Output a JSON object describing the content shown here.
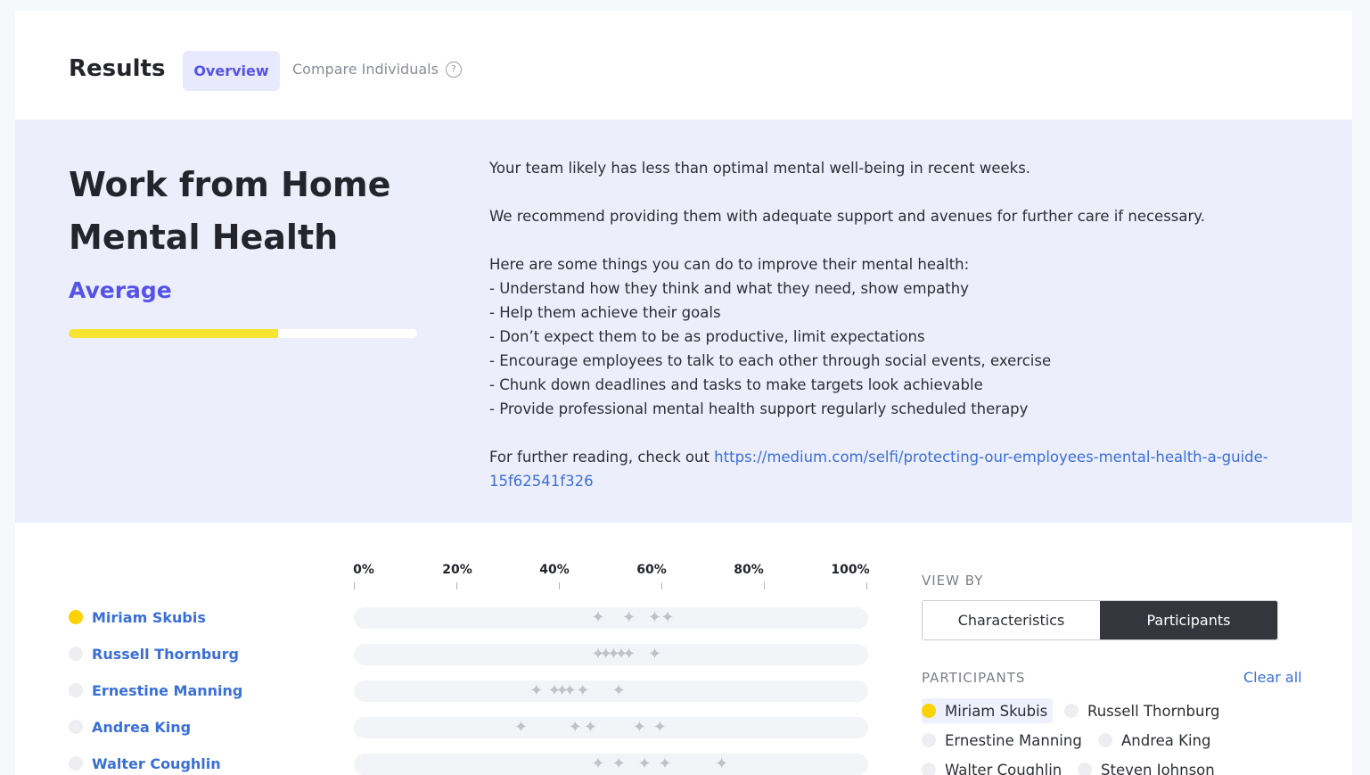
{
  "header": {
    "title": "Results",
    "tabs": [
      {
        "label": "Overview",
        "active": true
      },
      {
        "label": "Compare Individuals",
        "active": false
      }
    ]
  },
  "summary": {
    "title_line1": "Work from Home",
    "title_line2": "Mental Health",
    "level": "Average",
    "level_fraction": 0.6,
    "level_color": "#f7e531",
    "paragraph1": "Your team likely has less than optimal mental well-being in recent weeks.",
    "paragraph2": "We recommend providing them with adequate support and avenues for further care if necessary.",
    "tips_intro": "Here are some things you can do to improve their mental health:",
    "tips": [
      "- Understand how they think and what they need, show empathy",
      "- Help them achieve their goals",
      "- Don’t expect them to be as productive, limit expectations",
      "- Encourage employees to talk to each other through social events, exercise",
      "- Chunk down deadlines and tasks to make targets look achievable",
      "- Provide professional mental health support regularly scheduled therapy"
    ],
    "reading_prefix": " For further reading, check out ",
    "reading_link": "https://medium.com/selfi/protecting-our-employees-mental-health-a-guide-15f62541f326"
  },
  "chart": {
    "axis_labels": [
      "0%",
      "20%",
      "40%",
      "60%",
      "80%",
      "100%"
    ],
    "rows": [
      {
        "name": "Miriam Skubis",
        "active": true,
        "scores": [
          47.5,
          53.5,
          58.5,
          61
        ]
      },
      {
        "name": "Russell Thornburg",
        "active": false,
        "scores": [
          47.5,
          49,
          50.5,
          52,
          53.5,
          58.5
        ]
      },
      {
        "name": "Ernestine Manning",
        "active": false,
        "scores": [
          35.5,
          39,
          40.5,
          42,
          44.5,
          51.5
        ]
      },
      {
        "name": "Andrea King",
        "active": false,
        "scores": [
          32.5,
          43,
          46,
          55.5,
          59.5
        ]
      },
      {
        "name": "Walter Coughlin",
        "active": false,
        "scores": [
          47.5,
          51.5,
          56.5,
          60.5,
          71.5
        ]
      }
    ]
  },
  "view_by": {
    "label": "VIEW BY",
    "options": [
      {
        "label": "Characteristics",
        "active": false
      },
      {
        "label": "Participants",
        "active": true
      }
    ]
  },
  "participants_panel": {
    "label": "PARTICIPANTS",
    "clear_all": "Clear all",
    "chips": [
      {
        "name": "Miriam Skubis",
        "active": true
      },
      {
        "name": "Russell Thornburg",
        "active": false
      },
      {
        "name": "Ernestine Manning",
        "active": false
      },
      {
        "name": "Andrea King",
        "active": false
      },
      {
        "name": "Walter Coughlin",
        "active": false
      },
      {
        "name": "Steven Johnson",
        "active": false
      }
    ]
  },
  "colors": {
    "accent": "#5553e6",
    "link": "#3a6fd8",
    "highlight": "#fbd300",
    "summary_bg": "#eceefc"
  },
  "icons": {
    "help": "question-circle-icon",
    "marker": "four-point-star-icon"
  }
}
